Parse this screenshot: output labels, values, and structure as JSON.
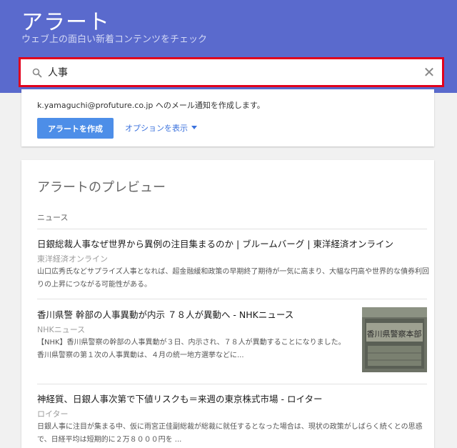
{
  "header": {
    "title": "アラート",
    "subtitle": "ウェブ上の面白い新着コンテンツをチェック"
  },
  "search": {
    "value": "人事"
  },
  "create": {
    "notify_text": "k.yamaguchi@profuture.co.jp へのメール通知を作成します。",
    "button_label": "アラートを作成",
    "options_label": "オプションを表示"
  },
  "preview": {
    "title": "アラートのプレビュー",
    "section": "ニュース",
    "articles": [
      {
        "title": "日銀総裁人事なぜ世界から異例の注目集まるのか | ブルームバーグ | 東洋経済オンライン",
        "source": "東洋経済オンライン",
        "snippet": "山口広秀氏などサプライズ人事となれば、超金融緩和政策の早期終了期待が一気に高まり、大幅な円高や世界的な債券利回りの上昇につながる可能性がある。"
      },
      {
        "title": "香川県警 幹部の人事異動が内示 ７８人が異動へ - NHKニュース",
        "source": "NHKニュース",
        "snippet": "【NHK】香川県警察の幹部の人事異動が３日、内示され、７８人が異動することになりました。 香川県警察の第１次の人事異動は、４月の統一地方選挙などに...",
        "thumb_text": "香川県警察本部"
      },
      {
        "title": "神経質、日銀人事次第で下値リスクも＝来週の東京株式市場 - ロイター",
        "source": "ロイター",
        "snippet": "日銀人事に注目が集まる中、仮に雨宮正佳副総裁が総裁に就任するとなった場合は、現状の政策がしばらく続くとの思惑で、日経平均は短期的に２万８０００円を ..."
      }
    ]
  },
  "colors": {
    "header": "#5a6acd",
    "highlight_border": "#e1001c",
    "button": "#4d8ee8",
    "link": "#3b72dd"
  }
}
